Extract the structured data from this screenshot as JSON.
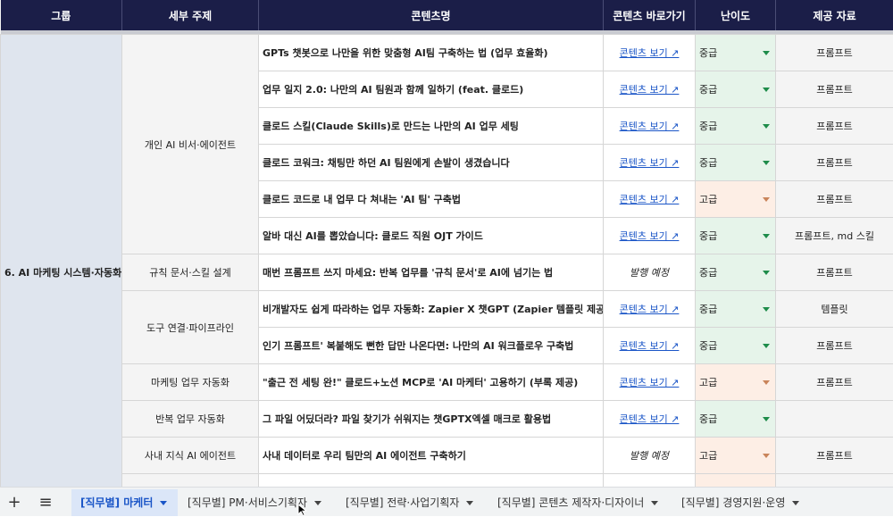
{
  "headers": [
    "그룹",
    "세부 주제",
    "콘텐츠명",
    "콘텐츠 바로가기",
    "난이도",
    "제공 자료"
  ],
  "group": "6. AI 마케팅 시스템·자동화",
  "link_label": "콘텐츠 보기 ↗",
  "pending_label": "발행 예정",
  "rows": [
    {
      "sub": "개인 AI 비서·에이전트",
      "title": "GPTs 챗봇으로 나만을 위한 맞춤형 AI팀 구축하는 법 (업무 효율화)",
      "difficulty": "중급",
      "resource": "프롬프트"
    },
    {
      "sub": "",
      "title": "업무 일지 2.0: 나만의 AI 팀원과 함께 일하기 (feat. 클로드)",
      "difficulty": "중급",
      "resource": "프롬프트"
    },
    {
      "sub": "",
      "title": "클로드 스킬(Claude Skills)로 만드는 나만의 AI 업무 세팅",
      "difficulty": "중급",
      "resource": "프롬프트"
    },
    {
      "sub": "",
      "title": "클로드 코워크: 채팅만 하던 AI 팀원에게 손발이 생겼습니다",
      "difficulty": "중급",
      "resource": "프롬프트"
    },
    {
      "sub": "",
      "title": "클로드 코드로 내 업무 다 쳐내는 'AI 팀' 구축법",
      "difficulty": "고급",
      "resource": "프롬프트"
    },
    {
      "sub": "",
      "title": "알바 대신 AI를 뽑았습니다: 클로드 직원 OJT 가이드",
      "difficulty": "중급",
      "resource": "프롬프트, md 스킬"
    },
    {
      "sub": "규칙 문서·스킬 설계",
      "title": "매번 프롬프트 쓰지 마세요: 반복 업무를 '규칙 문서'로 AI에 넘기는 법",
      "difficulty": "중급",
      "resource": "프롬프트"
    },
    {
      "sub": "도구 연결·파이프라인",
      "title": "비개발자도 쉽게 따라하는 업무 자동화: Zapier X 챗GPT (Zapier 템플릿 제공)",
      "difficulty": "중급",
      "resource": "템플릿"
    },
    {
      "sub": "",
      "title": "인기 프롬프트' 복붙해도 뻔한 답만 나온다면: 나만의 AI 워크플로우 구축법",
      "difficulty": "중급",
      "resource": "프롬프트"
    },
    {
      "sub": "마케팅 업무 자동화",
      "title": "\"출근 전 세팅 완!\" 클로드+노션 MCP로 'AI 마케터' 고용하기 (부록 제공)",
      "difficulty": "고급",
      "resource": "프롬프트"
    },
    {
      "sub": "반복 업무 자동화",
      "title": "그 파일 어딨더라? 파일 찾기가 쉬워지는 챗GPTX엑셀 매크로 활용법",
      "difficulty": "중급",
      "resource": ""
    },
    {
      "sub": "사내 지식 AI 에이전트",
      "title": "사내 데이터로 우리 팀만의 AI 에이전트 구축하기",
      "difficulty": "고급",
      "resource": "프롬프트"
    }
  ],
  "tabbar": {
    "add_label": "+",
    "menu_label": "≡",
    "tabs": [
      {
        "label": "[직무별] 마케터"
      },
      {
        "label": "[직무별] PM·서비스기획자"
      },
      {
        "label": "[직무별] 전략·사업기획자"
      },
      {
        "label": "[직무별] 콘텐츠 제작자·디자이너"
      },
      {
        "label": "[직무별] 경영지원·운영"
      }
    ]
  },
  "colors": {
    "header_bg": "#1b1e48",
    "mid_bg": "#e6f4ea",
    "high_bg": "#fdeee5",
    "active_tab": "#1a55c7"
  }
}
